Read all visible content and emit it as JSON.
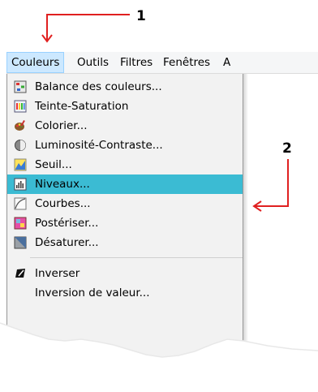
{
  "callouts": {
    "first": "1",
    "second": "2"
  },
  "menubar": {
    "items": [
      "Couleurs",
      "Outils",
      "Filtres",
      "Fenêtres",
      "A"
    ]
  },
  "menu": {
    "items": [
      {
        "label": "Balance des couleurs...",
        "icon": "color-balance-icon"
      },
      {
        "label": "Teinte-Saturation",
        "icon": "hue-saturation-icon"
      },
      {
        "label": "Colorier...",
        "icon": "colorize-icon"
      },
      {
        "label": "Luminosité-Contraste...",
        "icon": "brightness-contrast-icon"
      },
      {
        "label": "Seuil...",
        "icon": "threshold-icon"
      },
      {
        "label": "Niveaux...",
        "icon": "levels-icon"
      },
      {
        "label": "Courbes...",
        "icon": "curves-icon"
      },
      {
        "label": "Postériser...",
        "icon": "posterize-icon"
      },
      {
        "label": "Désaturer...",
        "icon": "desaturate-icon"
      },
      {
        "label": "Inverser",
        "icon": "invert-icon"
      },
      {
        "label": "Inversion de valeur...",
        "icon": ""
      }
    ]
  },
  "colors": {
    "highlight": "#3bbbd3",
    "active_menu": "#cce8ff",
    "arrow": "#e02020"
  }
}
